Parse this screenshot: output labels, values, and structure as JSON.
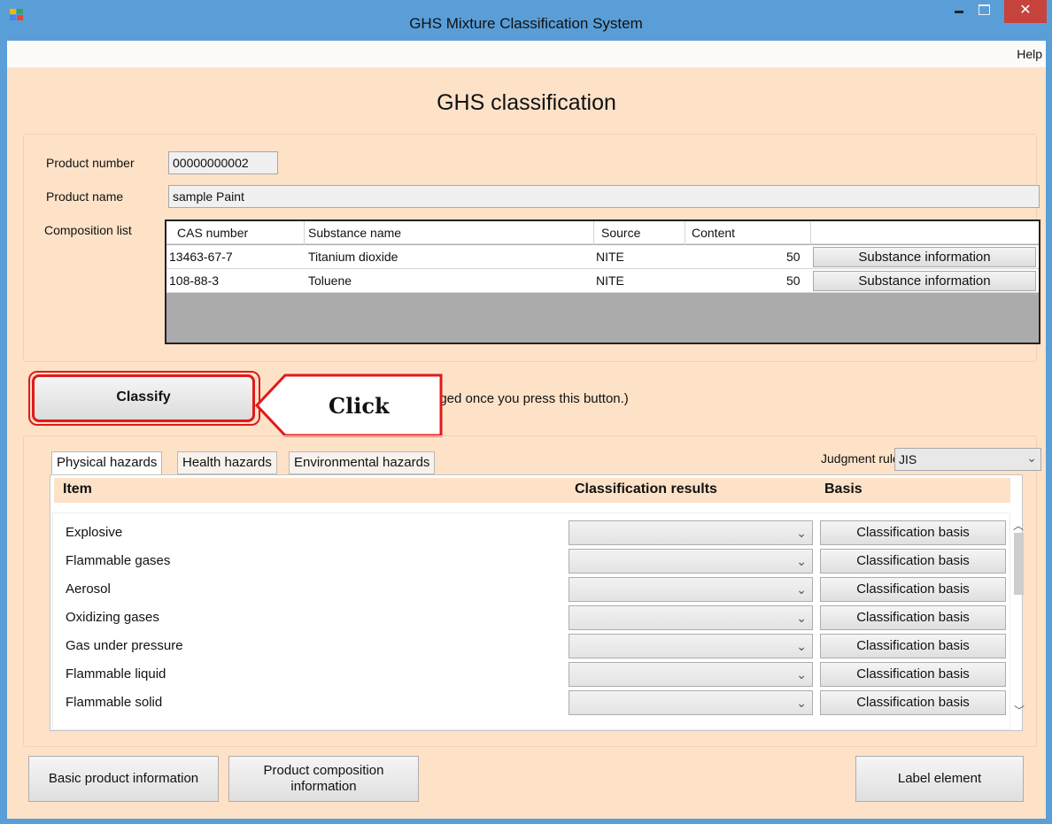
{
  "window": {
    "title": "GHS Mixture Classification System",
    "close_glyph": "✕"
  },
  "menu": {
    "help": "Help"
  },
  "heading": "GHS classification",
  "product": {
    "number_label": "Product number",
    "number_value": "00000000002",
    "name_label": "Product name",
    "name_value": "sample Paint",
    "composition_label": "Composition list"
  },
  "composition": {
    "headers": {
      "cas": "CAS number",
      "name": "Substance name",
      "source": "Source",
      "content": "Content"
    },
    "rows": [
      {
        "cas": "13463-67-7",
        "name": "Titanium dioxide",
        "source": "NITE",
        "content": "50",
        "button": "Substance information"
      },
      {
        "cas": "108-88-3",
        "name": "Toluene",
        "source": "NITE",
        "content": "50",
        "button": "Substance information"
      }
    ]
  },
  "classify": {
    "button": "Classify",
    "note": "nged once you press this button.)",
    "callout": "Click"
  },
  "tabs": [
    "Physical hazards",
    "Health hazards",
    "Environmental hazards"
  ],
  "judgment": {
    "label": "Judgment rule",
    "value": "JIS"
  },
  "list": {
    "headers": {
      "item": "Item",
      "results": "Classification results",
      "basis": "Basis"
    },
    "items": [
      {
        "label": "Explosive",
        "basis": "Classification basis"
      },
      {
        "label": "Flammable gases",
        "basis": "Classification basis"
      },
      {
        "label": "Aerosol",
        "basis": "Classification basis"
      },
      {
        "label": "Oxidizing gases",
        "basis": "Classification basis"
      },
      {
        "label": "Gas under pressure",
        "basis": "Classification basis"
      },
      {
        "label": "Flammable liquid",
        "basis": "Classification basis"
      },
      {
        "label": "Flammable solid",
        "basis": "Classification basis"
      }
    ]
  },
  "bottom": {
    "basic": "Basic product information",
    "composition_line1": "Product composition",
    "composition_line2": "information",
    "label_element": "Label element"
  },
  "colors": {
    "titlebar": "#5a9ed8",
    "background": "#fde2c8",
    "highlight": "#e01a1a",
    "close": "#c7433d"
  }
}
